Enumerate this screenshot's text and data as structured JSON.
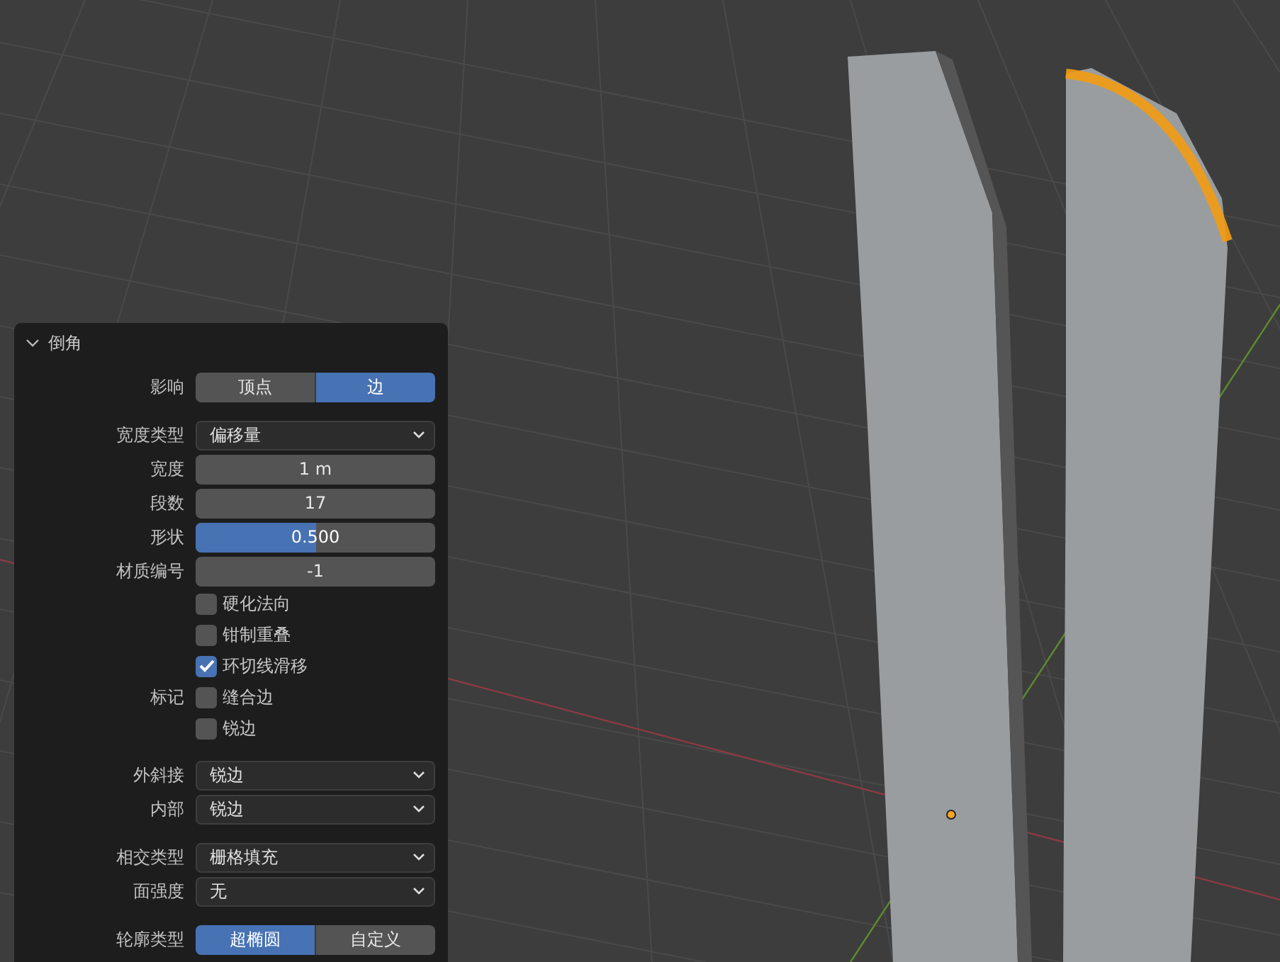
{
  "panel": {
    "title": "倒角",
    "expanded": true,
    "rows": [
      {
        "kind": "toggle",
        "label": "影响",
        "options": [
          {
            "label": "顶点",
            "selected": false
          },
          {
            "label": "边",
            "selected": true
          }
        ]
      },
      {
        "kind": "gap"
      },
      {
        "kind": "dropdown",
        "label": "宽度类型",
        "value": "偏移量"
      },
      {
        "kind": "number",
        "label": "宽度",
        "value": "1 m"
      },
      {
        "kind": "number",
        "label": "段数",
        "value": "17"
      },
      {
        "kind": "slider",
        "label": "形状",
        "value": "0.500",
        "level": 0.5
      },
      {
        "kind": "number",
        "label": "材质编号",
        "value": "-1"
      },
      {
        "kind": "checkbox",
        "text": "硬化法向",
        "checked": false
      },
      {
        "kind": "checkbox",
        "text": "钳制重叠",
        "checked": false
      },
      {
        "kind": "checkbox",
        "text": "环切线滑移",
        "checked": true
      },
      {
        "kind": "checkbox",
        "label": "标记",
        "text": "缝合边",
        "checked": false
      },
      {
        "kind": "checkbox",
        "text": "锐边",
        "checked": false
      },
      {
        "kind": "gap"
      },
      {
        "kind": "dropdown",
        "label": "外斜接",
        "value": "锐边"
      },
      {
        "kind": "dropdown",
        "label": "内部",
        "value": "锐边"
      },
      {
        "kind": "gap"
      },
      {
        "kind": "dropdown",
        "label": "相交类型",
        "value": "栅格填充"
      },
      {
        "kind": "dropdown",
        "label": "面强度",
        "value": "无"
      },
      {
        "kind": "gap"
      },
      {
        "kind": "toggle",
        "label": "轮廓类型",
        "options": [
          {
            "label": "超椭圆",
            "selected": true
          },
          {
            "label": "自定义",
            "selected": false
          }
        ]
      }
    ]
  }
}
